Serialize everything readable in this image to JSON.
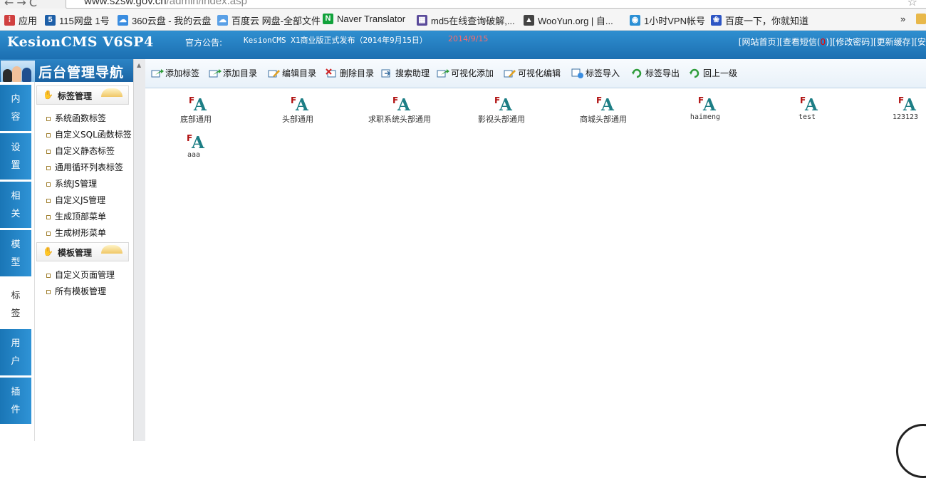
{
  "browser": {
    "nav_icons": "←→C",
    "url_host": "www.szsw.gov.cn",
    "url_path": "/admin/index.asp",
    "bookmarks": [
      {
        "label": "应用",
        "icon": "apps-icon",
        "color": "#d04040"
      },
      {
        "label": "115网盘 1号",
        "icon": "115-icon",
        "color": "#1d5fa8"
      },
      {
        "label": "360云盘 - 我的云盘",
        "icon": "cloud-icon",
        "color": "#3a8de0"
      },
      {
        "label": "百度云 网盘-全部文件",
        "icon": "baidu-cloud-icon",
        "color": "#5aa0e6"
      },
      {
        "label": "Naver Translator",
        "icon": "naver-icon",
        "color": "#11a23b"
      },
      {
        "label": "md5在线查询破解,...",
        "icon": "grid-icon",
        "color": "#5a4a9a"
      },
      {
        "label": "WooYun.org | 自...",
        "icon": "wooyun-icon",
        "color": "#444"
      },
      {
        "label": "1小时VPN帐号",
        "icon": "vpn-icon",
        "color": "#2a8fd5"
      },
      {
        "label": "百度一下，你就知道",
        "icon": "baidu-paw-icon",
        "color": "#2d55c4"
      }
    ],
    "more": "»"
  },
  "header": {
    "logo": "KesionCMS V6SP4",
    "notice_label": "官方公告:",
    "notice_text": "KesionCMS X1商业版正式发布（2014年9月15日）",
    "notice_date": "2014/9/15",
    "links": [
      "[网站首页]",
      "[查看短信(",
      "0",
      ")]",
      "[修改密码]",
      "[更新缓存]",
      "[安"
    ]
  },
  "sidebar": {
    "title": "后台管理导航",
    "tabs": [
      {
        "label": "内容",
        "active": false
      },
      {
        "label": "设置",
        "active": false
      },
      {
        "label": "相关",
        "active": false
      },
      {
        "label": "模型",
        "active": false
      },
      {
        "label": "标签",
        "active": true
      },
      {
        "label": "用户",
        "active": false
      },
      {
        "label": "插件",
        "active": false
      }
    ],
    "groups": [
      {
        "title": "标签管理",
        "items": [
          "系统函数标签",
          "自定义SQL函数标签",
          "自定义静态标签",
          "通用循环列表标签",
          "系统JS管理",
          "自定义JS管理",
          "生成顶部菜单",
          "生成树形菜单"
        ]
      },
      {
        "title": "模板管理",
        "items": [
          "自定义页面管理",
          "所有模板管理"
        ]
      }
    ]
  },
  "toolbar": {
    "buttons": [
      {
        "label": "添加标签",
        "icon": "add-tag-icon"
      },
      {
        "label": "添加目录",
        "icon": "add-folder-icon"
      },
      {
        "label": "编辑目录",
        "icon": "edit-folder-icon"
      },
      {
        "label": "删除目录",
        "icon": "delete-folder-icon"
      },
      {
        "label": "搜索助理",
        "icon": "search-assistant-icon"
      },
      {
        "label": "可视化添加",
        "icon": "visual-add-icon"
      },
      {
        "label": "可视化编辑",
        "icon": "visual-edit-icon"
      },
      {
        "label": "标签导入",
        "icon": "import-icon"
      },
      {
        "label": "标签导出",
        "icon": "export-icon"
      },
      {
        "label": "回上一级",
        "icon": "back-up-icon"
      }
    ]
  },
  "tags": [
    {
      "name": "底部通用"
    },
    {
      "name": "头部通用"
    },
    {
      "name": "求职系统头部通用"
    },
    {
      "name": "影视头部通用"
    },
    {
      "name": "商城头部通用"
    },
    {
      "name": "haimeng"
    },
    {
      "name": "test"
    },
    {
      "name": "123123"
    },
    {
      "name": "aaa"
    }
  ],
  "tag_glyph": {
    "f": "F",
    "a": "A"
  }
}
